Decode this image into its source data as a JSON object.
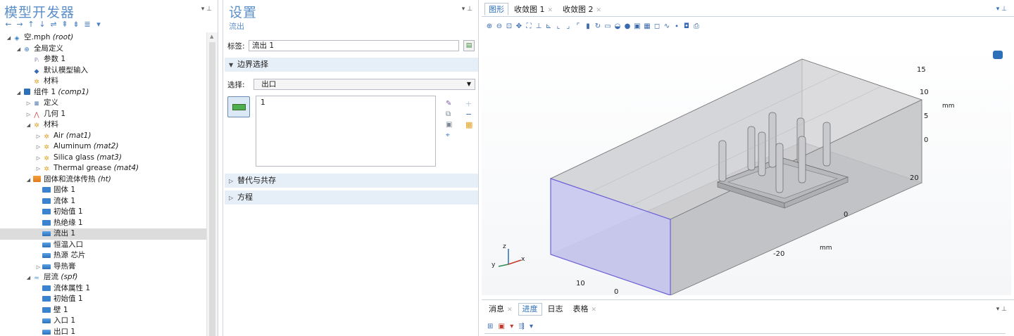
{
  "model_builder": {
    "title": "模型开发器",
    "pin": "▾ ⊥",
    "nav_icons": [
      "←",
      "→",
      "↑",
      "↓",
      "⇌",
      "⇞",
      "⇟",
      "≣",
      "▾"
    ],
    "tree": [
      {
        "indent": 0,
        "twisty": "◢",
        "icon": "root",
        "label": "空.mph",
        "tag": "(root)"
      },
      {
        "indent": 1,
        "twisty": "◢",
        "icon": "globe",
        "label": "全局定义",
        "tag": ""
      },
      {
        "indent": 2,
        "twisty": "",
        "icon": "param",
        "label": "参数 1",
        "tag": ""
      },
      {
        "indent": 2,
        "twisty": "",
        "icon": "default",
        "label": "默认模型输入",
        "tag": ""
      },
      {
        "indent": 2,
        "twisty": "",
        "icon": "mat",
        "label": "材料",
        "tag": ""
      },
      {
        "indent": 1,
        "twisty": "◢",
        "icon": "comp",
        "label": "组件 1",
        "tag": "(comp1)"
      },
      {
        "indent": 2,
        "twisty": "▷",
        "icon": "def",
        "label": "定义",
        "tag": ""
      },
      {
        "indent": 2,
        "twisty": "▷",
        "icon": "geo",
        "label": "几何 1",
        "tag": ""
      },
      {
        "indent": 2,
        "twisty": "◢",
        "icon": "mat",
        "label": "材料",
        "tag": ""
      },
      {
        "indent": 3,
        "twisty": "▷",
        "icon": "mat",
        "label": "Air",
        "tag": "(mat1)"
      },
      {
        "indent": 3,
        "twisty": "▷",
        "icon": "mat",
        "label": "Aluminum",
        "tag": "(mat2)"
      },
      {
        "indent": 3,
        "twisty": "▷",
        "icon": "mat",
        "label": "Silica glass",
        "tag": "(mat3)"
      },
      {
        "indent": 3,
        "twisty": "▷",
        "icon": "mat",
        "label": "Thermal grease",
        "tag": "(mat4)"
      },
      {
        "indent": 2,
        "twisty": "◢",
        "icon": "ht",
        "label": "固体和流体传热",
        "tag": "(ht)"
      },
      {
        "indent": 3,
        "twisty": "",
        "icon": "phys",
        "label": "固体 1",
        "tag": ""
      },
      {
        "indent": 3,
        "twisty": "",
        "icon": "phys",
        "label": "流体 1",
        "tag": ""
      },
      {
        "indent": 3,
        "twisty": "",
        "icon": "phys",
        "label": "初始值 1",
        "tag": ""
      },
      {
        "indent": 3,
        "twisty": "",
        "icon": "phys",
        "label": "热绝缘 1",
        "tag": ""
      },
      {
        "indent": 3,
        "twisty": "",
        "icon": "phys2",
        "label": "流出 1",
        "tag": "",
        "selected": true
      },
      {
        "indent": 3,
        "twisty": "",
        "icon": "phys2",
        "label": "恒温入口",
        "tag": ""
      },
      {
        "indent": 3,
        "twisty": "",
        "icon": "phys2",
        "label": "热源 芯片",
        "tag": ""
      },
      {
        "indent": 3,
        "twisty": "▷",
        "icon": "phys2",
        "label": "导热膏",
        "tag": ""
      },
      {
        "indent": 2,
        "twisty": "◢",
        "icon": "spf",
        "label": "层流",
        "tag": "(spf)"
      },
      {
        "indent": 3,
        "twisty": "",
        "icon": "phys",
        "label": "流体属性 1",
        "tag": ""
      },
      {
        "indent": 3,
        "twisty": "",
        "icon": "phys",
        "label": "初始值 1",
        "tag": ""
      },
      {
        "indent": 3,
        "twisty": "",
        "icon": "phys",
        "label": "壁 1",
        "tag": ""
      },
      {
        "indent": 3,
        "twisty": "",
        "icon": "phys2",
        "label": "入口 1",
        "tag": ""
      },
      {
        "indent": 3,
        "twisty": "",
        "icon": "phys2",
        "label": "出口 1",
        "tag": ""
      }
    ]
  },
  "settings": {
    "title": "设置",
    "subtitle": "流出",
    "pin": "▾ ⊥",
    "label_caption": "标签:",
    "label_value": "流出 1",
    "boundary_section": "边界选择",
    "selection_caption": "选择:",
    "selection_value": "出口",
    "selection_list": [
      "1"
    ],
    "section_override": "替代与共存",
    "section_equation": "方程"
  },
  "graphics": {
    "tabs": [
      {
        "label": "图形",
        "active": true,
        "closable": false
      },
      {
        "label": "收敛图 1",
        "active": false,
        "closable": true
      },
      {
        "label": "收敛图 2",
        "active": false,
        "closable": true
      }
    ],
    "pin": "▾ ⊥",
    "toolbar_icons": [
      "zoom-in",
      "zoom-out",
      "zoom-box",
      "move",
      "zoom-extents",
      "axis",
      "views",
      "view-xy",
      "view-yz",
      "view-zx",
      "render",
      "rotate",
      "wireframe",
      "transparency",
      "light",
      "select",
      "select-domain",
      "select-boundary",
      "select-edge",
      "select-point",
      "screenshot",
      "print"
    ],
    "axis_labels": {
      "vertical_ticks": [
        "15",
        "10",
        "5",
        "0"
      ],
      "vertical_unit": "mm",
      "right_ticks": [
        "20",
        "0",
        "-20"
      ],
      "right_unit": "mm",
      "front_ticks": [
        "10",
        "0"
      ],
      "triad": {
        "x": "x",
        "y": "y",
        "z": "z"
      }
    }
  },
  "messages": {
    "tabs": [
      {
        "label": "消息",
        "active": false,
        "closable": true
      },
      {
        "label": "进度",
        "active": true,
        "closable": false
      },
      {
        "label": "日志",
        "active": false,
        "closable": false
      },
      {
        "label": "表格",
        "active": false,
        "closable": true
      }
    ],
    "pin": "▾ ⊥"
  }
}
